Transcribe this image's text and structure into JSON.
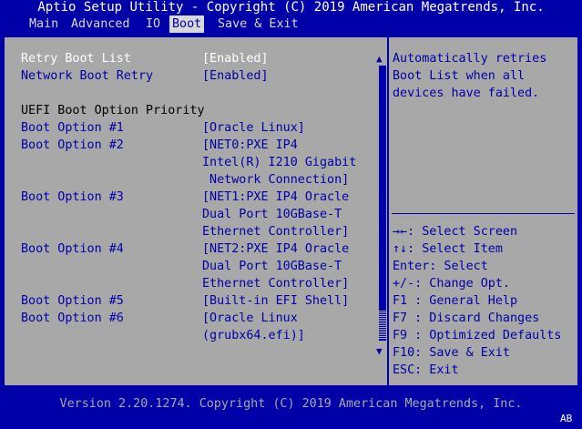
{
  "title": "Aptio Setup Utility - Copyright (C) 2019 American Megatrends, Inc.",
  "menu": {
    "tabs": [
      {
        "label": "Main"
      },
      {
        "label": "Advanced"
      },
      {
        "label": "IO"
      },
      {
        "label": "Boot"
      },
      {
        "label": "Save & Exit"
      }
    ],
    "active": "Boot"
  },
  "settings": {
    "retry_boot_list": {
      "label": "Retry Boot List",
      "value": "[Enabled]"
    },
    "network_boot_retry": {
      "label": "Network Boot Retry",
      "value": "[Enabled]"
    },
    "section_heading": "UEFI Boot Option Priority",
    "boot_options": [
      {
        "label": "Boot Option #1",
        "lines": [
          "[Oracle Linux]"
        ]
      },
      {
        "label": "Boot Option #2",
        "lines": [
          "[NET0:PXE IP4",
          "Intel(R) I210 Gigabit",
          " Network Connection]"
        ]
      },
      {
        "label": "Boot Option #3",
        "lines": [
          "[NET1:PXE IP4 Oracle",
          "Dual Port 10GBase-T",
          "Ethernet Controller]"
        ]
      },
      {
        "label": "Boot Option #4",
        "lines": [
          "[NET2:PXE IP4 Oracle",
          "Dual Port 10GBase-T",
          "Ethernet Controller]"
        ]
      },
      {
        "label": "Boot Option #5",
        "lines": [
          "[Built-in EFI Shell]"
        ]
      },
      {
        "label": "Boot Option #6",
        "lines": [
          "[Oracle Linux",
          "(grubx64.efi)]"
        ]
      }
    ]
  },
  "help": {
    "description": [
      "Automatically retries",
      "Boot List when all",
      "devices have failed."
    ],
    "keys": [
      {
        "key": "→←:",
        "action": " Select Screen"
      },
      {
        "key": "↑↓:",
        "action": " Select Item"
      },
      {
        "key": "Enter:",
        "action": " Select"
      },
      {
        "key": "+/-:",
        "action": " Change Opt."
      },
      {
        "key": "F1 :",
        "action": " General Help"
      },
      {
        "key": "F7 :",
        "action": " Discard Changes"
      },
      {
        "key": "F9 :",
        "action": " Optimized Defaults"
      },
      {
        "key": "F10:",
        "action": " Save & Exit"
      },
      {
        "key": "ESC:",
        "action": " Exit"
      }
    ]
  },
  "scrollbar": {
    "up_arrow": "▲",
    "down_arrow": "▼"
  },
  "footer": {
    "version": "Version 2.20.1274. Copyright (C) 2019 American Megatrends, Inc.",
    "badge": "AB"
  },
  "colors": {
    "background": "#0000a8",
    "panel": "#a8a8a8",
    "highlight_text": "#ffffff",
    "item_text": "#0000a8"
  }
}
